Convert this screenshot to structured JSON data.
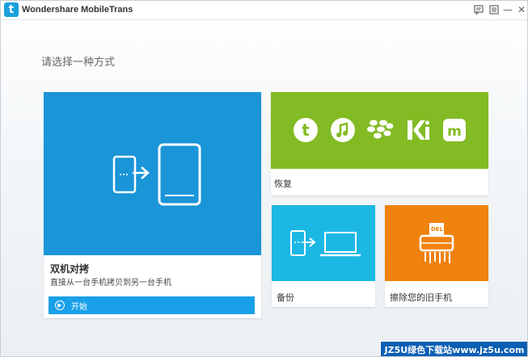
{
  "app": {
    "logo_letter": "t",
    "title": "Wondershare MobileTrans"
  },
  "titlebar_buttons": {
    "feedback_icon": "comment-icon",
    "menu_icon": "menu-icon",
    "minimize": "—",
    "close": "✕"
  },
  "main": {
    "heading": "请选择一种方式"
  },
  "tiles": {
    "switch": {
      "title": "双机对拷",
      "description": "直接从一台手机拷贝到另一台手机",
      "start_label": "开始",
      "color": "#1a95d8"
    },
    "restore": {
      "title": "恢复",
      "color": "#82bb24",
      "services": [
        "tunes-t-icon",
        "music-note-icon",
        "blackberry-icon",
        "kies-icon",
        "mobiletrans-icon"
      ]
    },
    "backup": {
      "title": "备份",
      "color": "#1cb8e4"
    },
    "erase": {
      "title": "擦除您的旧手机",
      "shredder_label": "DEL",
      "color": "#f0820e"
    }
  },
  "watermark": "JZ5U绿色下载站www.jz5u.com"
}
